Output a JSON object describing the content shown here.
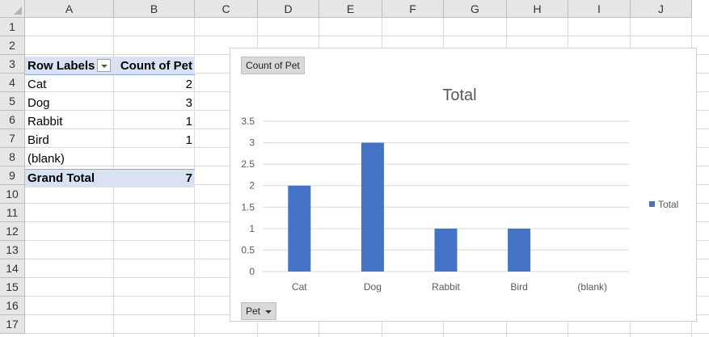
{
  "columns": [
    "A",
    "B",
    "C",
    "D",
    "E",
    "F",
    "G",
    "H",
    "I",
    "J"
  ],
  "rows": [
    "1",
    "2",
    "3",
    "4",
    "5",
    "6",
    "7",
    "8",
    "9",
    "10",
    "11",
    "12",
    "13",
    "14",
    "15",
    "16",
    "17"
  ],
  "pivot": {
    "row_labels_header": "Row Labels",
    "count_header": "Count of Pet",
    "rows": [
      {
        "label": "Cat",
        "count": "2"
      },
      {
        "label": "Dog",
        "count": "3"
      },
      {
        "label": "Rabbit",
        "count": "1"
      },
      {
        "label": "Bird",
        "count": "1"
      },
      {
        "label": "(blank)",
        "count": ""
      }
    ],
    "grand_total_label": "Grand Total",
    "grand_total_value": "7"
  },
  "chart": {
    "value_field_button": "Count of Pet",
    "axis_field_button": "Pet",
    "bar_color": "#4472c4"
  },
  "chart_data": {
    "type": "bar",
    "title": "Total",
    "categories": [
      "Cat",
      "Dog",
      "Rabbit",
      "Bird",
      "(blank)"
    ],
    "series": [
      {
        "name": "Total",
        "values": [
          2,
          3,
          1,
          1,
          null
        ]
      }
    ],
    "ylim": [
      0,
      3.5
    ],
    "yticks": [
      "0",
      "0.5",
      "1",
      "1.5",
      "2",
      "2.5",
      "3",
      "3.5"
    ],
    "grid": true,
    "legend": "right"
  }
}
